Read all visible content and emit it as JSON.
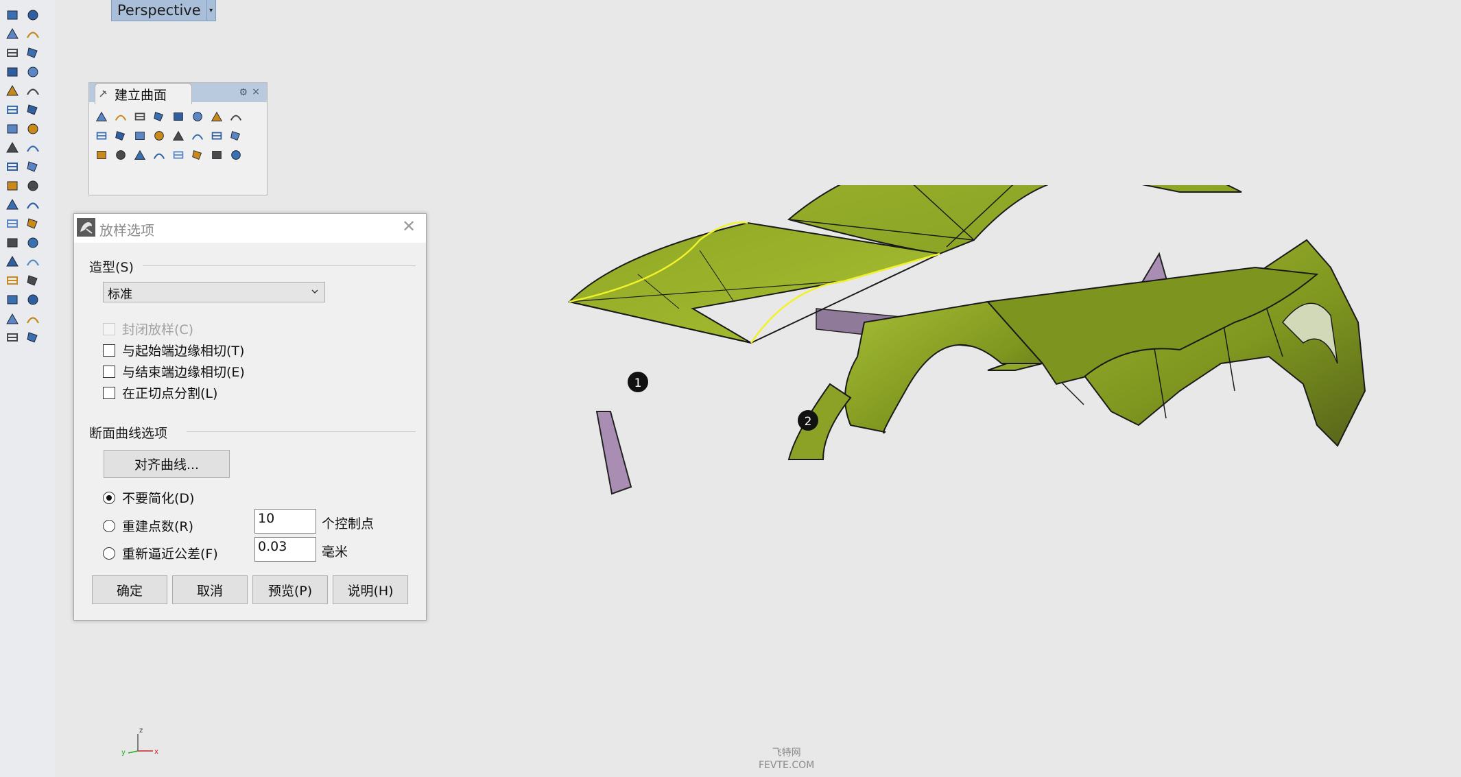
{
  "viewport": {
    "title": "Perspective"
  },
  "left_toolbar": {
    "icons": [
      "select-arrow-icon",
      "point-icon",
      "polyline-icon",
      "curve-points-icon",
      "circle-icon",
      "ellipse-icon",
      "polygon-icon",
      "rectangle-icon",
      "arc-icon",
      "fillet-curve-icon",
      "surface-points-icon",
      "loft-surface-icon",
      "box-solid-icon",
      "sphere-solid-icon",
      "cylinder-icon",
      "extrude-icon",
      "transform-gear-icon",
      "boolean-flash-icon",
      "join-icon",
      "trim-icon",
      "paint-bucket-icon",
      "array-points-icon",
      "curve-bend-icon",
      "curve-fillet-icon",
      "text-icon",
      "dimension-icon",
      "group-icon",
      "block-icon",
      "mesh-box-icon",
      "layer-edit-icon",
      "grid-array-icon",
      "gumball-icon",
      "clipboard-icon",
      "check-icon",
      "render-teapot-icon",
      "material-icon"
    ]
  },
  "surface_panel": {
    "tab_label": "建立曲面",
    "gear": "⚙",
    "close": "×",
    "icons": [
      "surface-from-3-points-icon",
      "sphere-surface-icon",
      "edge-surface-icon",
      "sweep1-icon",
      "planar-surface-icon",
      "patch-icon",
      "loft-icon",
      "rectangle-plane-icon",
      "extrude-curve-icon",
      "network-surface-icon",
      "revolve-icon",
      "render-surface-icon",
      "rail-revolve-icon",
      "sweep2-icon",
      "drape-icon",
      "cone-icon",
      "blend-surface-icon",
      "cap-icon",
      "sweep-1-2-icon",
      "heightfield-icon",
      "bell-icon",
      "dome-icon",
      "image-plane-icon",
      "point-grid-icon"
    ]
  },
  "loft_dialog": {
    "title": "放样选项",
    "close": "✕",
    "style_group": "造型(S)",
    "style_value": "标准",
    "options": [
      {
        "label": "封闭放样(C)",
        "checked": false,
        "enabled": false
      },
      {
        "label": "与起始端边缘相切(T)",
        "checked": false,
        "enabled": true
      },
      {
        "label": "与结束端边缘相切(E)",
        "checked": false,
        "enabled": true
      },
      {
        "label": "在正切点分割(L)",
        "checked": false,
        "enabled": true
      }
    ],
    "section_group": "断面曲线选项",
    "align_button": "对齐曲线...",
    "radios": [
      {
        "label": "不要简化(D)",
        "selected": true
      },
      {
        "label": "重建点数(R)",
        "selected": false
      },
      {
        "label": "重新逼近公差(F)",
        "selected": false
      }
    ],
    "rebuild_value": "10",
    "rebuild_unit": "个控制点",
    "refit_value": "0.03",
    "refit_unit": "毫米",
    "buttons": {
      "ok": "确定",
      "cancel": "取消",
      "preview": "预览(P)",
      "help": "说明(H)"
    }
  },
  "scene": {
    "curve_markers": [
      "1",
      "2"
    ],
    "body_color": "#8ea829",
    "interior_color": "#a98db3",
    "curve_color": "#f2f22a"
  },
  "axis": {
    "x": "x",
    "y": "y",
    "z": "z"
  },
  "watermark": {
    "line1": "飞特网",
    "line2": "FEVTE.COM"
  }
}
